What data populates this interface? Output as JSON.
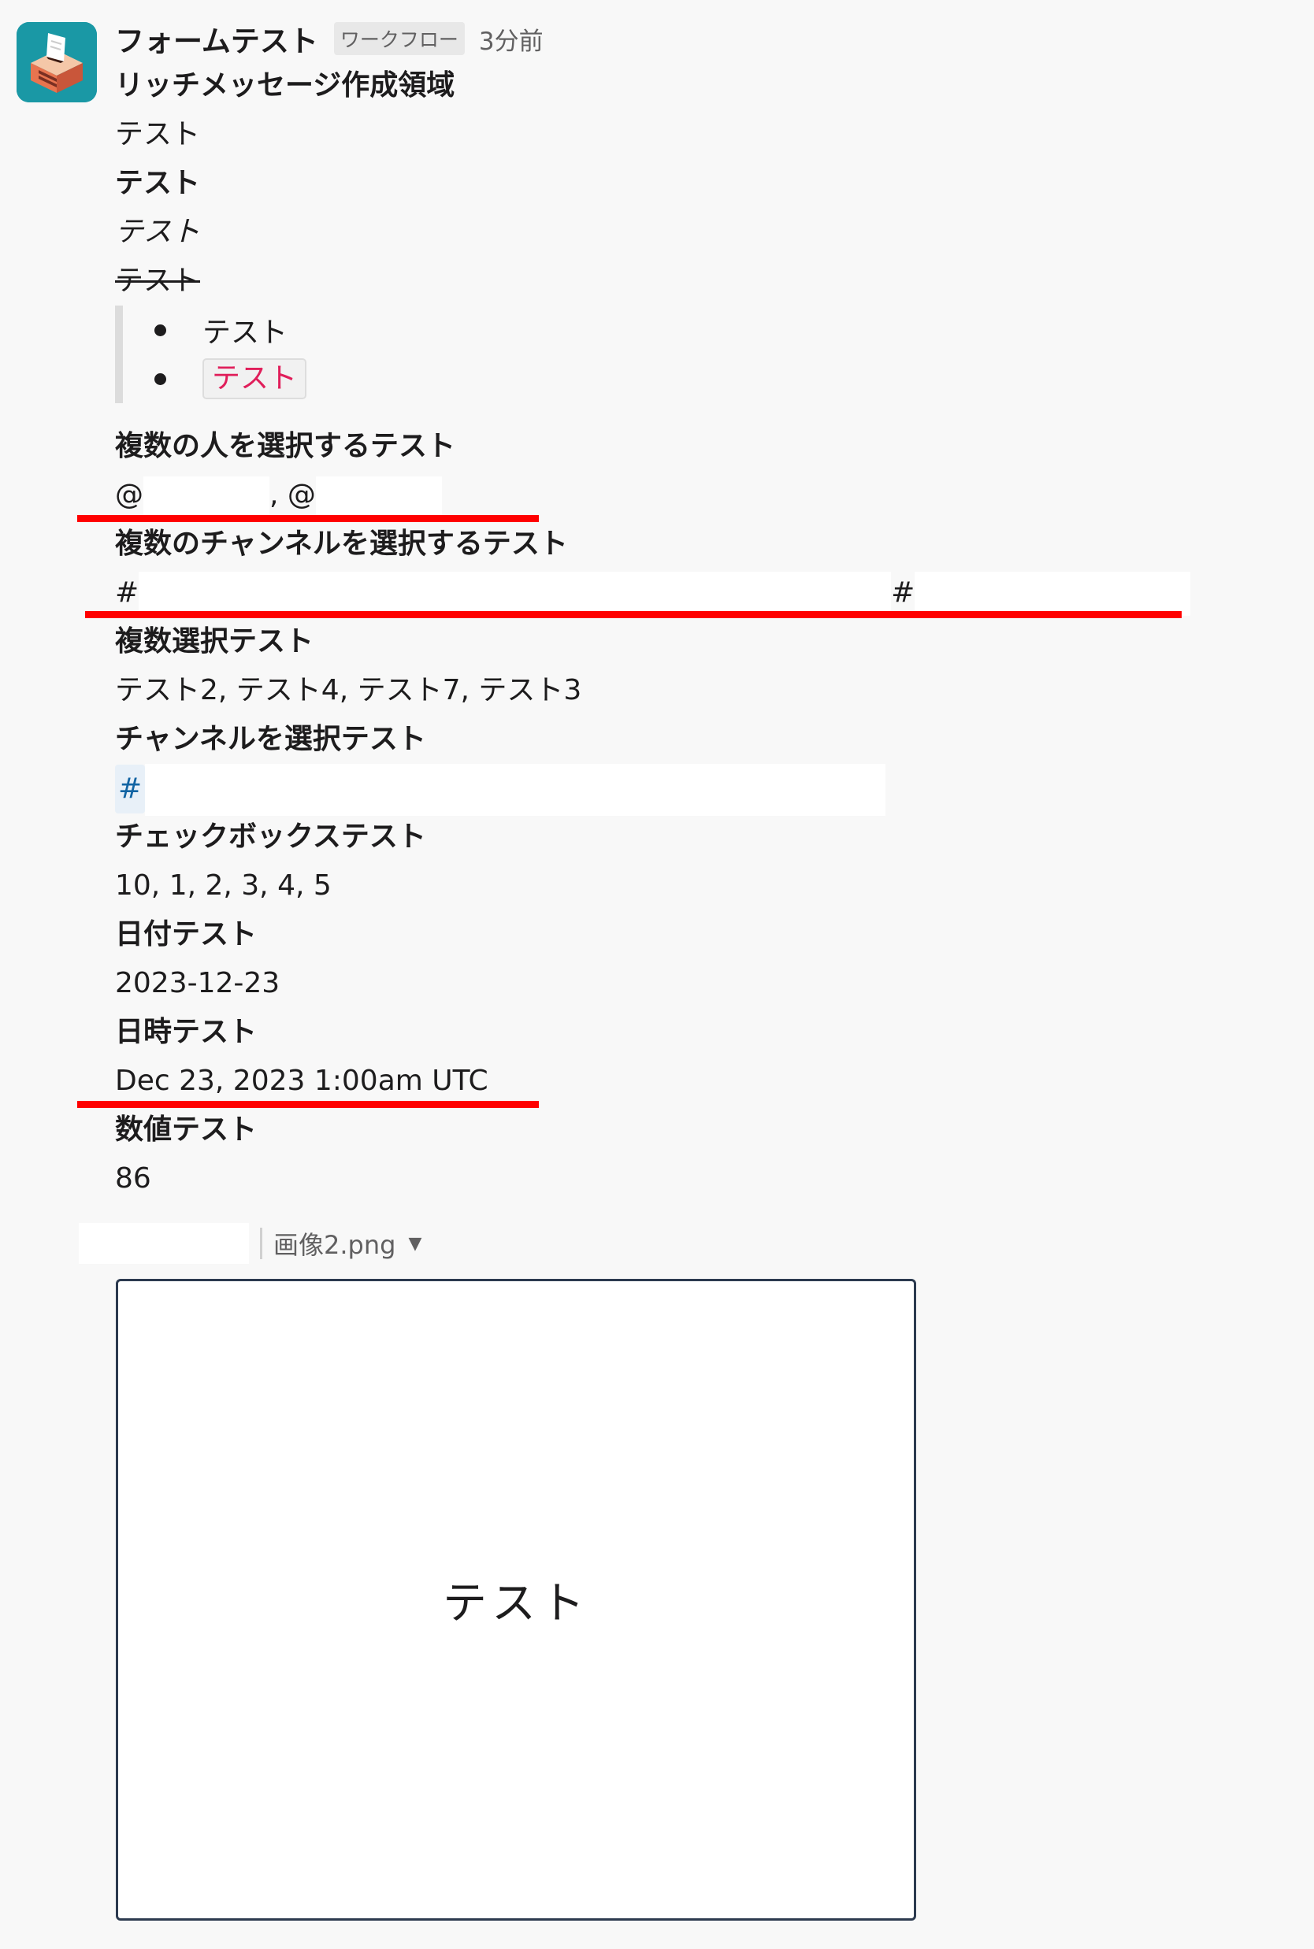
{
  "app": {
    "name": "フォームテスト",
    "badge": "ワークフロー",
    "time": "3分前",
    "icon": "ballot-box-icon"
  },
  "message": {
    "rich_title": "リッチメッセージ作成領域",
    "plain": "テスト",
    "bold": "テスト",
    "italic": "テスト",
    "strike": "テスト",
    "bullets": [
      "テスト",
      "テスト"
    ]
  },
  "fields": {
    "multi_user_label": "複数の人を選択するテスト",
    "multi_user_prefix_1": "@",
    "multi_user_sep": ",",
    "multi_user_prefix_2": "@",
    "multi_channel_label": "複数のチャンネルを選択するテスト",
    "multi_channel_prefix_1": "#",
    "multi_channel_prefix_2": "#",
    "multi_select_label": "複数選択テスト",
    "multi_select_value": "テスト2, テスト4, テスト7, テスト3",
    "channel_select_label": "チャンネルを選択テスト",
    "channel_select_prefix": "#",
    "checkbox_label": "チェックボックステスト",
    "checkbox_value": "10, 1, 2, 3, 4, 5",
    "date_label": "日付テスト",
    "date_value": "2023-12-23",
    "datetime_label": "日時テスト",
    "datetime_value": "Dec 23, 2023 1:00am UTC",
    "number_label": "数値テスト",
    "number_value": "86"
  },
  "attachment": {
    "filename": "画像2.png",
    "preview_text": "テスト"
  },
  "colors": {
    "underline": "#ff0000",
    "code_text": "#e01e5a",
    "link": "#1264a3",
    "icon_bg": "#1a98a5"
  }
}
